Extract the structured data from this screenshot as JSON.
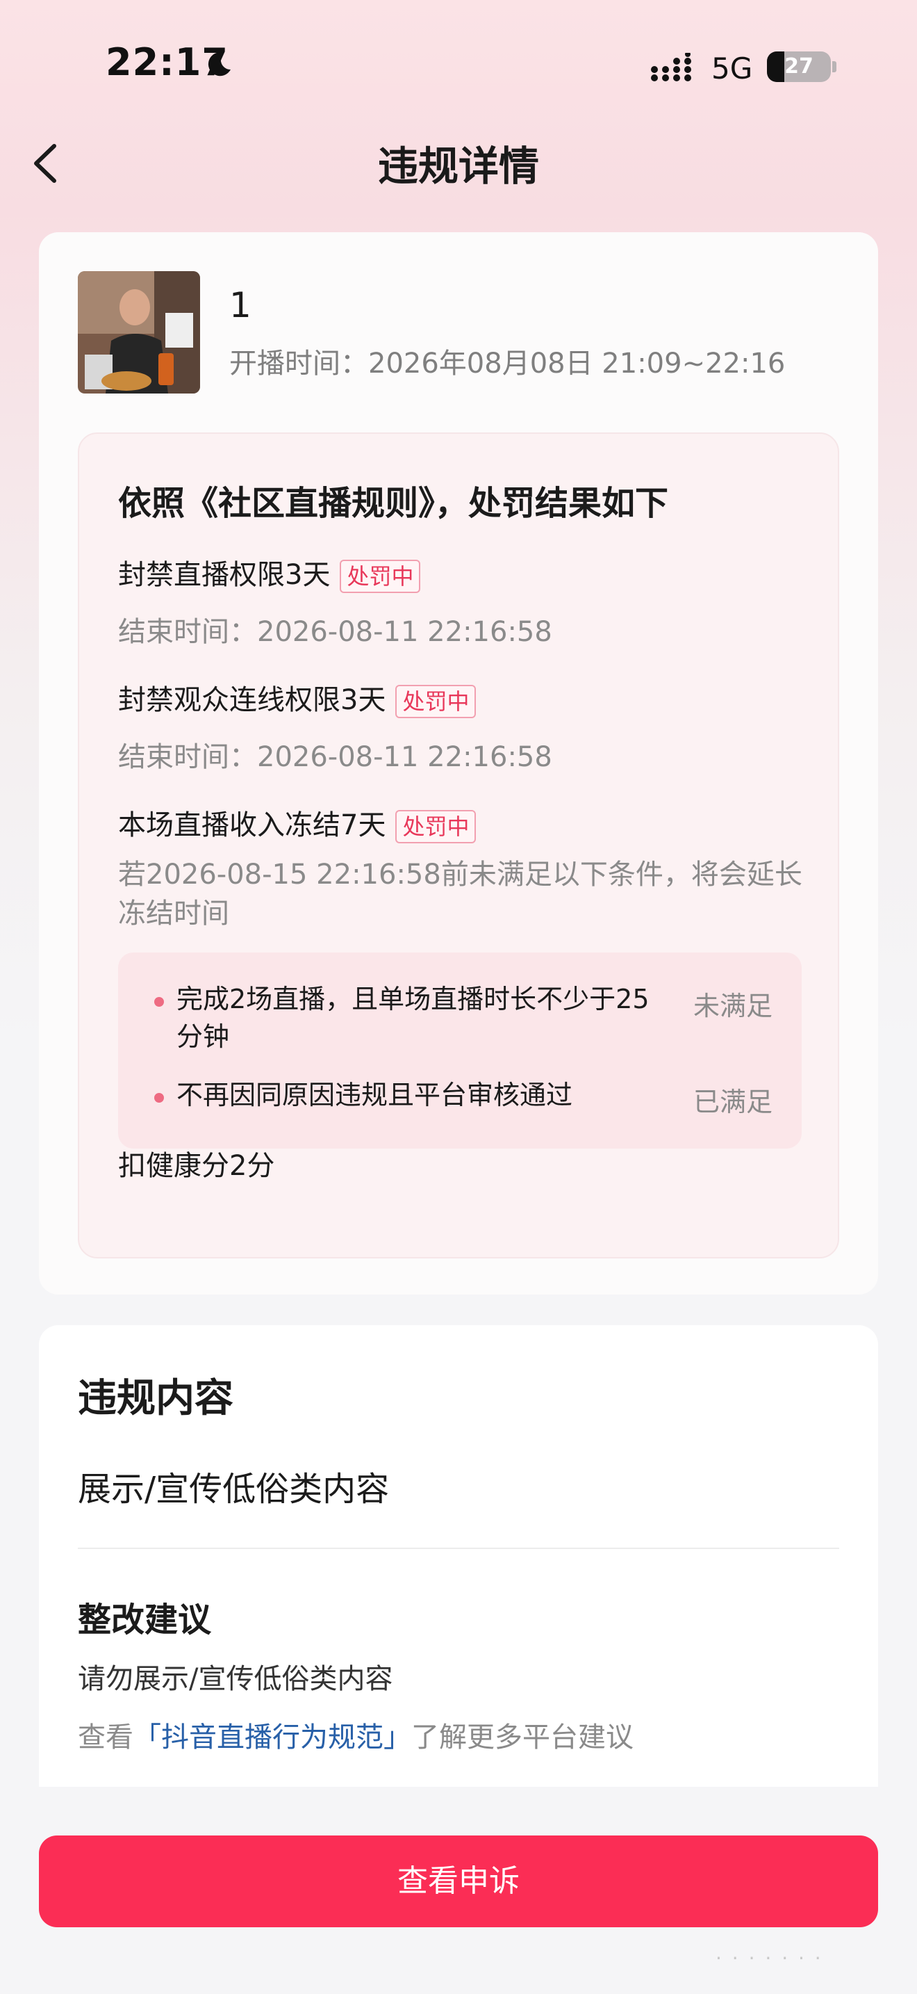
{
  "status_bar": {
    "time": "22:17",
    "network": "5G",
    "battery": "27",
    "battery_level": 0.27
  },
  "nav": {
    "title": "违规详情"
  },
  "stream": {
    "name": "1",
    "time": "开播时间：2026年08月08日 21:09~22:16"
  },
  "penalty": {
    "heading": "依照《社区直播规则》，处罚结果如下",
    "items": [
      {
        "title": "封禁直播权限3天",
        "badge": "处罚中",
        "end": "结束时间：2026-08-11 22:16:58"
      },
      {
        "title": "封禁观众连线权限3天",
        "badge": "处罚中",
        "end": "结束时间：2026-08-11 22:16:58"
      },
      {
        "title": "本场直播收入冻结7天",
        "badge": "处罚中",
        "note": "若2026-08-15 22:16:58前未满足以下条件，将会延长冻结时间"
      }
    ],
    "conditions": [
      {
        "text": "完成2场直播，且单场直播时长不少于25分钟",
        "status": "未满足"
      },
      {
        "text": "不再因同原因违规且平台审核通过",
        "status": "已满足"
      }
    ],
    "health": "扣健康分2分"
  },
  "violation": {
    "heading": "违规内容",
    "content": "展示/宣传低俗类内容",
    "suggestion_heading": "整改建议",
    "suggestion_text": "请勿展示/宣传低俗类内容",
    "more_prefix": "查看",
    "more_link": "「抖音直播行为规范」",
    "more_suffix": "了解更多平台建议"
  },
  "action": {
    "appeal": "查看申诉"
  },
  "icons": {
    "back": "back-arrow-icon",
    "moon": "moon-icon",
    "signal": "signal-icon"
  },
  "colors": {
    "accent": "#fb2d55",
    "badge": "#e8385a",
    "link": "#2860a8"
  }
}
